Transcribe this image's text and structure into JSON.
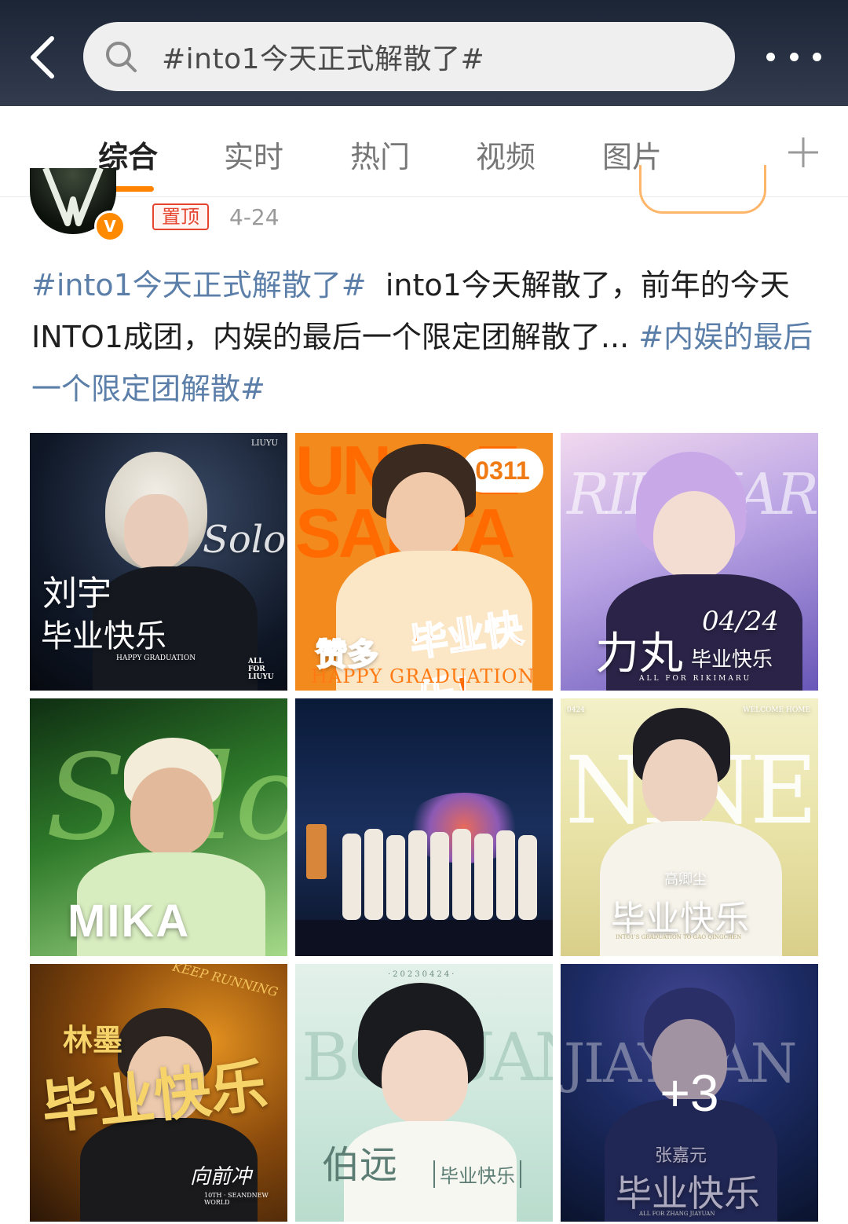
{
  "header": {
    "back_icon": "chevron-left-icon",
    "search_icon": "search-icon",
    "search_query": "#into1今天正式解散了#",
    "more_icon": "more-dots-icon"
  },
  "tabs": {
    "items": [
      {
        "label": "综合",
        "active": true
      },
      {
        "label": "实时",
        "active": false
      },
      {
        "label": "热门",
        "active": false
      },
      {
        "label": "视频",
        "active": false
      },
      {
        "label": "图片",
        "active": false
      }
    ],
    "add_icon": "plus-icon",
    "accent_color": "#ff8200"
  },
  "post": {
    "verified_mark": "V",
    "pinned_label": "置顶",
    "date": "4-24",
    "text": {
      "hashtag1": "#into1今天正式解散了#",
      "body": "into1今天解散了，前年的今天 INTO1成团，内娱的最后一个限定团解散了...",
      "hashtag2": "#内娱的最后一个限定团解散#"
    },
    "images": {
      "tile1": {
        "name1": "刘宇",
        "caption": "毕业快乐",
        "script": "Solo",
        "corner": "LIUYU",
        "footer": "HAPPY GRADUATION",
        "tag": "ALL FOR LIUYU"
      },
      "tile2": {
        "big": "UNCLE SANTA",
        "badge": "0311",
        "name": "赞多",
        "caption": "毕业快乐!",
        "footer": "HAPPY GRADUATION"
      },
      "tile3": {
        "bg_word": "RIKIMARU",
        "name": "力丸",
        "date": "04/24",
        "caption": "毕业快乐",
        "footer": "ALL FOR RIKIMARU"
      },
      "tile4": {
        "script": "Solo",
        "name": "MIKA"
      },
      "tile5": {},
      "tile6": {
        "bg_word": "NINE",
        "top_left": "0424",
        "top_right": "WELCOME HOME",
        "name": "高卿尘",
        "caption": "毕业快乐",
        "footer": "INTO1'S GRADUATION TO GAO QINGCHEN"
      },
      "tile7": {
        "corner": "KEEP RUNNING",
        "name": "林墨",
        "caption": "毕业快乐",
        "slogan": "向前冲",
        "footer": "10TH · SEANDNEW WORLD"
      },
      "tile8": {
        "date": "·20230424·",
        "bg_word": "BOYUAN",
        "name": "伯远",
        "caption": "毕业快乐"
      },
      "tile9": {
        "bg_word": "JIAYUAN",
        "name": "张嘉元",
        "caption": "毕业快乐",
        "more_count": "+3",
        "footer": "ALL FOR ZHANG JIAYUAN"
      }
    }
  }
}
